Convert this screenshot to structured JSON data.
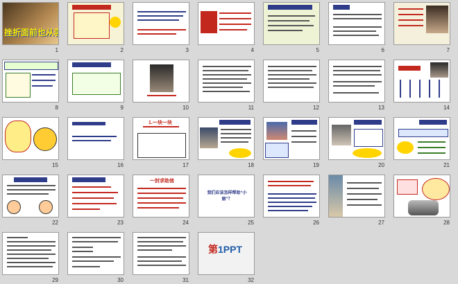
{
  "slides": [
    {
      "number": "1"
    },
    {
      "number": "2"
    },
    {
      "number": "3"
    },
    {
      "number": "4"
    },
    {
      "number": "5"
    },
    {
      "number": "6"
    },
    {
      "number": "7"
    },
    {
      "number": "8"
    },
    {
      "number": "9"
    },
    {
      "number": "10"
    },
    {
      "number": "11"
    },
    {
      "number": "12"
    },
    {
      "number": "13"
    },
    {
      "number": "14"
    },
    {
      "number": "15"
    },
    {
      "number": "16"
    },
    {
      "number": "17"
    },
    {
      "number": "18"
    },
    {
      "number": "19"
    },
    {
      "number": "20"
    },
    {
      "number": "21"
    },
    {
      "number": "22"
    },
    {
      "number": "23"
    },
    {
      "number": "24"
    },
    {
      "number": "25"
    },
    {
      "number": "26"
    },
    {
      "number": "27"
    },
    {
      "number": "28"
    },
    {
      "number": "29"
    },
    {
      "number": "30"
    },
    {
      "number": "31"
    },
    {
      "number": "32"
    }
  ],
  "cover_title": "挫折面前也从容",
  "slide17_title": "1.一块一块",
  "slide24_title": "一封求助信",
  "slide25_title": "我们应该怎样帮助“小丽”？",
  "slide32_logo_prefix": "第",
  "slide32_logo_main": "1PPT",
  "colors": {
    "background": "#d9d9d9",
    "title_blue": "#2f3c8a",
    "title_red": "#c3281e",
    "title_yellow": "#ffe600"
  }
}
